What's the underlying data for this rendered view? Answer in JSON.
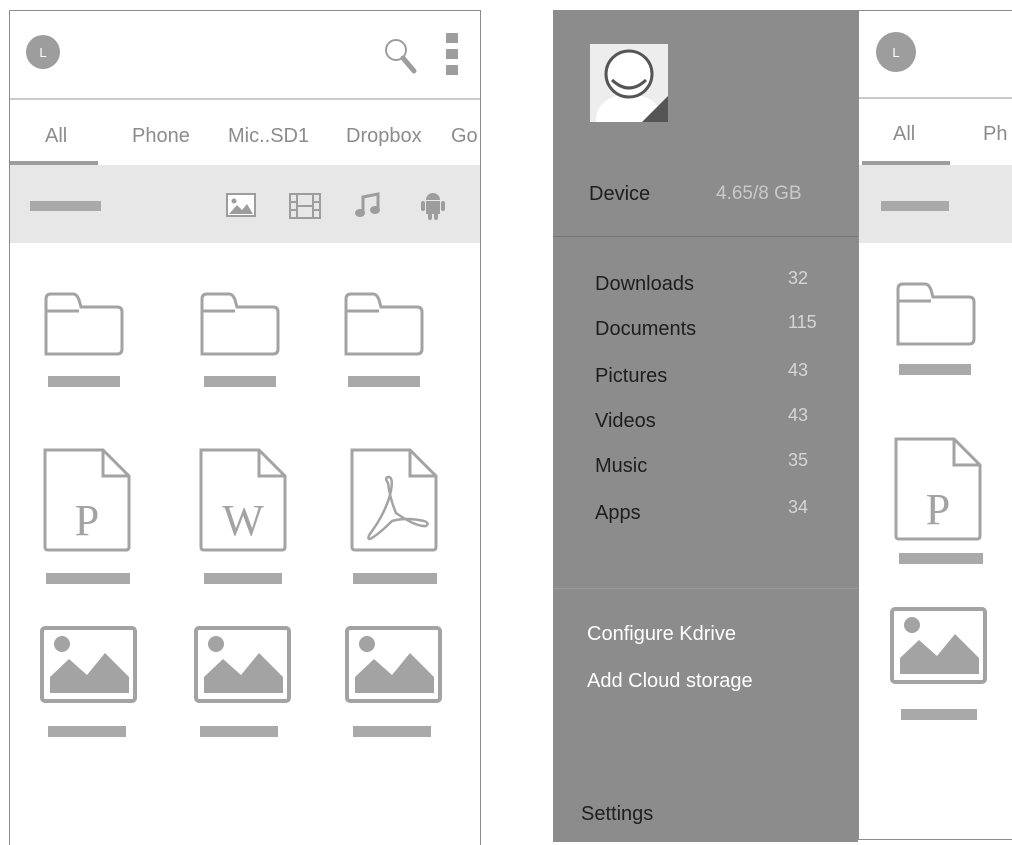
{
  "left_screen": {
    "avatar_letter": "L",
    "tabs": [
      "All",
      "Phone",
      "Mic..SD1",
      "Dropbox",
      "Go"
    ],
    "filter_icons": [
      "image-icon",
      "film-icon",
      "music-note-icon",
      "android-icon"
    ],
    "file_icons": [
      "folder-icon",
      "folder-icon",
      "folder-icon",
      "powerpoint-file-icon",
      "word-file-icon",
      "pdf-file-icon",
      "image-file-icon",
      "image-file-icon",
      "image-file-icon"
    ]
  },
  "drawer": {
    "device_label": "Device",
    "storage": "4.65/8 GB",
    "folders": [
      {
        "label": "Downloads",
        "count": "32"
      },
      {
        "label": "Documents",
        "count": "115"
      },
      {
        "label": "Pictures",
        "count": "43"
      },
      {
        "label": "Videos",
        "count": "43"
      },
      {
        "label": "Music",
        "count": "35"
      },
      {
        "label": "Apps",
        "count": "34"
      }
    ],
    "configure_label": "Configure Kdrive",
    "add_cloud_label": "Add Cloud storage",
    "settings_label": "Settings"
  },
  "right_screen": {
    "avatar_letter": "L",
    "tabs": [
      "All",
      "Ph"
    ]
  },
  "colors": {
    "drawer_bg": "#8c8c8c",
    "icon_gray": "#a3a3a3",
    "filter_bar_bg": "#e7e7e7"
  }
}
